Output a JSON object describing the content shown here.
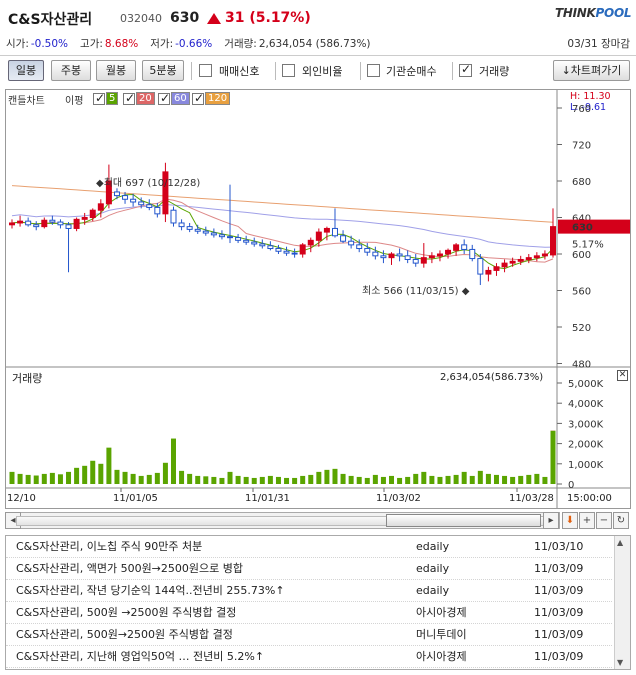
{
  "header": {
    "name": "C&S자산관리",
    "code": "032040",
    "price": "630",
    "change": "31 (5.17%)",
    "logo_a": "THINK",
    "logo_b": "POOL",
    "open_label": "시가:",
    "open_val": "-0.50%",
    "high_label": "고가:",
    "high_val": "8.68%",
    "low_label": "저가:",
    "low_val": "-0.66%",
    "volume_label": "거래량:",
    "volume_val": "2,634,054 (586.73%)",
    "date": "03/31 장마감"
  },
  "toolbar": {
    "daily": "일봉",
    "weekly": "주봉",
    "monthly": "월봉",
    "min5": "5분봉",
    "signal": "매매신호",
    "foreign": "외인비율",
    "inst": "기관순매수",
    "vol": "거래량",
    "export": "↓차트펴가기"
  },
  "legend": {
    "candle": "캔들차트",
    "ma_label": "이평",
    "ma5": "5",
    "ma20": "20",
    "ma60": "60",
    "ma120": "120"
  },
  "hl": {
    "high": "H: 11.30",
    "low": "L: -9.61"
  },
  "price_chart": {
    "yticks": [
      "760",
      "720",
      "680",
      "640",
      "600",
      "560",
      "520",
      "480"
    ],
    "current": "630",
    "current_pct": "5.17%",
    "max_label": "최대 697 (10/12/28)",
    "min_label": "최소 566 (11/03/15)"
  },
  "volume": {
    "title": "거래량",
    "value": "2,634,054(586.73%)",
    "yticks": [
      "5,000K",
      "4,000K",
      "3,000K",
      "2,000K",
      "1,000K",
      "0"
    ]
  },
  "time": {
    "labels": [
      "12/10",
      "11/01/05",
      "11/01/31",
      "11/03/02",
      "11/03/28"
    ],
    "end": "15:00:00"
  },
  "news": [
    {
      "title": "C&S자산관리, 이노칩 주식 90만주 처분",
      "src": "edaily",
      "date": "11/03/10"
    },
    {
      "title": "C&S자산관리, 액면가 500원→2500원으로 병합",
      "src": "edaily",
      "date": "11/03/09"
    },
    {
      "title": "C&S자산관리, 작년 당기순익 144억..전년비 255.73%↑",
      "src": "edaily",
      "date": "11/03/09"
    },
    {
      "title": "C&S자산관리, 500원 →2500원 주식병합 결정",
      "src": "아시아경제",
      "date": "11/03/09"
    },
    {
      "title": "C&S자산관리, 500원→2500원 주식병합 결정",
      "src": "머니투데이",
      "date": "11/03/09"
    },
    {
      "title": "C&S자산관리, 지난해 영업익50억 … 전년비 5.2%↑",
      "src": "아시아경제",
      "date": "11/03/09"
    }
  ],
  "colors": {
    "up": "#d4001a",
    "down": "#2255cc",
    "volume": "#5aa400",
    "ma20": "#e8a070",
    "ma60": "#a0a0e8"
  },
  "chart_data": [
    {
      "type": "candlestick",
      "title": "캔들차트",
      "y_ticks": [
        760,
        720,
        680,
        640,
        600,
        560,
        520,
        480
      ],
      "x_tick_labels": [
        "12/10",
        "11/01/05",
        "11/01/31",
        "11/03/02",
        "11/03/28"
      ],
      "candles": [
        [
          632,
          638,
          628,
          634
        ],
        [
          634,
          642,
          630,
          636
        ],
        [
          636,
          640,
          630,
          632
        ],
        [
          632,
          636,
          626,
          630
        ],
        [
          630,
          640,
          628,
          637
        ],
        [
          637,
          642,
          632,
          635
        ],
        [
          635,
          638,
          628,
          632
        ],
        [
          632,
          635,
          580,
          628
        ],
        [
          628,
          640,
          625,
          638
        ],
        [
          638,
          645,
          632,
          640
        ],
        [
          640,
          650,
          636,
          648
        ],
        [
          648,
          660,
          640,
          655
        ],
        [
          655,
          698,
          650,
          680
        ],
        [
          668,
          672,
          660,
          664
        ],
        [
          664,
          668,
          655,
          660
        ],
        [
          660,
          666,
          652,
          657
        ],
        [
          657,
          662,
          650,
          654
        ],
        [
          654,
          660,
          648,
          651
        ],
        [
          651,
          656,
          640,
          644
        ],
        [
          644,
          700,
          635,
          690
        ],
        [
          648,
          652,
          630,
          634
        ],
        [
          634,
          638,
          626,
          630
        ],
        [
          630,
          634,
          624,
          627
        ],
        [
          627,
          632,
          622,
          625
        ],
        [
          625,
          630,
          620,
          623
        ],
        [
          623,
          628,
          618,
          621
        ],
        [
          621,
          626,
          616,
          619
        ],
        [
          619,
          676,
          612,
          618
        ],
        [
          618,
          622,
          612,
          615
        ],
        [
          615,
          620,
          610,
          613
        ],
        [
          613,
          618,
          608,
          611
        ],
        [
          611,
          616,
          606,
          609
        ],
        [
          609,
          614,
          604,
          606
        ],
        [
          606,
          610,
          600,
          603
        ],
        [
          603,
          608,
          598,
          601
        ],
        [
          601,
          606,
          596,
          600
        ],
        [
          600,
          612,
          596,
          610
        ],
        [
          610,
          618,
          602,
          615
        ],
        [
          615,
          628,
          608,
          624
        ],
        [
          624,
          630,
          615,
          628
        ],
        [
          628,
          650,
          618,
          620
        ],
        [
          620,
          626,
          612,
          614
        ],
        [
          614,
          620,
          606,
          610
        ],
        [
          610,
          616,
          602,
          606
        ],
        [
          606,
          612,
          598,
          602
        ],
        [
          602,
          608,
          594,
          598
        ],
        [
          598,
          604,
          590,
          596
        ],
        [
          596,
          602,
          588,
          600
        ],
        [
          600,
          606,
          592,
          598
        ],
        [
          598,
          604,
          590,
          594
        ],
        [
          594,
          600,
          586,
          590
        ],
        [
          590,
          612,
          585,
          596
        ],
        [
          596,
          602,
          590,
          598
        ],
        [
          598,
          604,
          592,
          600
        ],
        [
          600,
          606,
          595,
          604
        ],
        [
          604,
          612,
          598,
          610
        ],
        [
          610,
          616,
          600,
          605
        ],
        [
          605,
          610,
          592,
          595
        ],
        [
          595,
          600,
          566,
          578
        ],
        [
          578,
          586,
          570,
          582
        ],
        [
          582,
          590,
          576,
          586
        ],
        [
          586,
          594,
          580,
          590
        ],
        [
          590,
          596,
          586,
          592
        ],
        [
          592,
          598,
          588,
          594
        ],
        [
          594,
          600,
          590,
          596
        ],
        [
          596,
          602,
          592,
          598
        ],
        [
          598,
          604,
          594,
          600
        ],
        [
          599,
          650,
          596,
          630
        ]
      ]
    },
    {
      "type": "bar",
      "title": "거래량",
      "y_ticks": [
        "5,000K",
        "4,000K",
        "3,000K",
        "2,000K",
        "1,000K",
        "0"
      ],
      "values_k": [
        600,
        500,
        450,
        420,
        500,
        550,
        480,
        600,
        800,
        900,
        1150,
        1000,
        1800,
        700,
        600,
        500,
        400,
        450,
        550,
        1050,
        2250,
        650,
        500,
        400,
        380,
        350,
        300,
        600,
        400,
        350,
        300,
        350,
        400,
        350,
        300,
        300,
        400,
        450,
        600,
        700,
        750,
        500,
        400,
        350,
        300,
        450,
        350,
        400,
        300,
        350,
        500,
        600,
        400,
        350,
        400,
        450,
        600,
        400,
        650,
        500,
        450,
        400,
        350,
        400,
        450,
        500,
        350,
        2634
      ]
    }
  ]
}
